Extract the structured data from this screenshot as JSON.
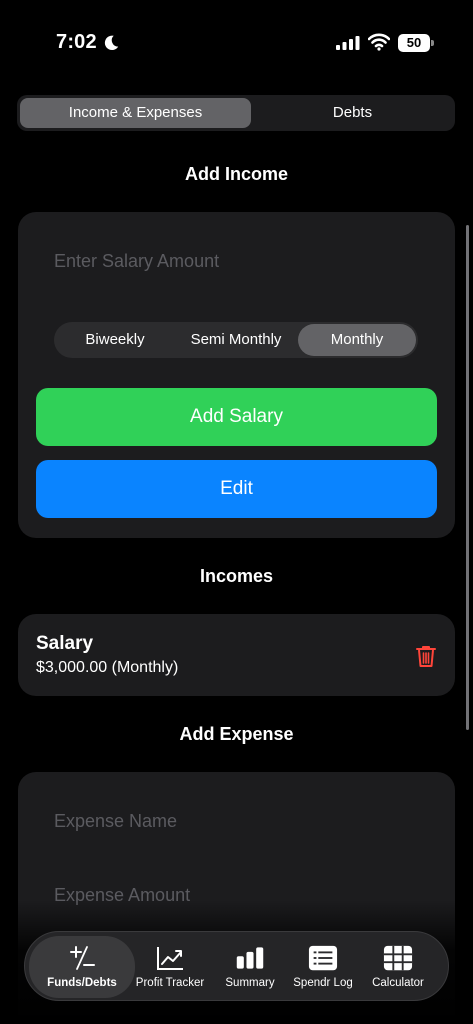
{
  "status_bar": {
    "time": "7:02",
    "battery": "50"
  },
  "top_tabs": [
    {
      "label": "Income & Expenses",
      "selected": true
    },
    {
      "label": "Debts",
      "selected": false
    }
  ],
  "add_income": {
    "title": "Add Income",
    "salary_placeholder": "Enter Salary Amount",
    "frequency_options": [
      "Biweekly",
      "Semi Monthly",
      "Monthly"
    ],
    "selected_frequency": "Monthly",
    "add_button": "Add Salary",
    "edit_button": "Edit"
  },
  "incomes": {
    "title": "Incomes",
    "items": [
      {
        "name": "Salary",
        "amount": "$3,000.00 (Monthly)"
      }
    ]
  },
  "add_expense": {
    "title": "Add Expense",
    "name_placeholder": "Expense Name",
    "amount_placeholder": "Expense Amount"
  },
  "tab_bar": [
    {
      "label": "Funds/Debts",
      "icon": "plus-minus-icon",
      "active": true
    },
    {
      "label": "Profit Tracker",
      "icon": "chart-trend-icon",
      "active": false
    },
    {
      "label": "Summary",
      "icon": "bar-chart-icon",
      "active": false
    },
    {
      "label": "Spendr Log",
      "icon": "list-icon",
      "active": false
    },
    {
      "label": "Calculator",
      "icon": "calculator-grid-icon",
      "active": false
    }
  ],
  "colors": {
    "green": "#30d158",
    "blue": "#0a84ff",
    "delete_red": "#ff453a",
    "card": "#1c1c1e"
  }
}
